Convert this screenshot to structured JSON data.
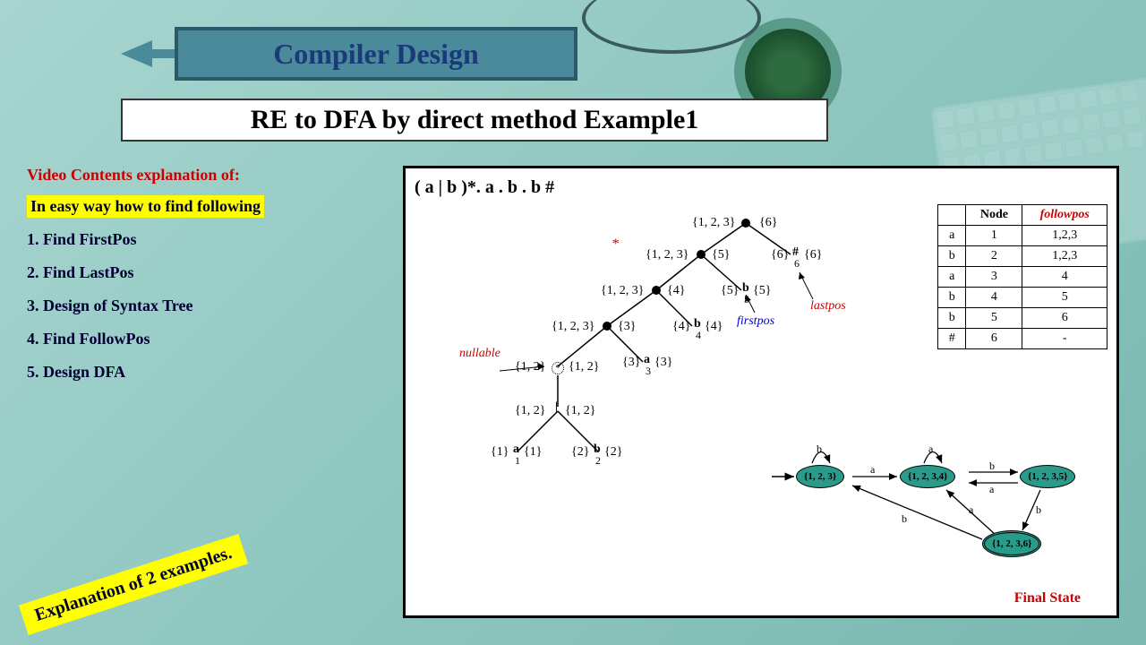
{
  "title": "Compiler Design",
  "subtitle": "RE to DFA by direct method Example1",
  "contents_header": "Video Contents explanation of:",
  "highlight": "In easy way how to find following",
  "items": [
    "1.  Find FirstPos",
    "2.  Find LastPos",
    "3.  Design of Syntax Tree",
    "4.  Find FollowPos",
    "5.  Design DFA"
  ],
  "badge": "Explanation of 2 examples.",
  "expression": "( a | b )*. a . b . b #",
  "tree_labels": {
    "nullable": "nullable",
    "firstpos": "firstpos",
    "lastpos": "lastpos",
    "root_l": "{1, 2, 3}",
    "root_r": "{6}",
    "n5_l": "{1, 2, 3}",
    "n5_r": "{5}",
    "n4_l": "{1, 2, 3}",
    "n4_r": "{4}",
    "n3_l": "{1, 2, 3}",
    "n3_r": "{3}",
    "star_l": "{1, 2}",
    "star_r": "{1, 2}",
    "or_l": "{1, 2}",
    "or_r": "{1, 2}",
    "a1_l": "{1}",
    "a1": "a",
    "a1_sub": "1",
    "a1_r": "{1}",
    "b2_l": "{2}",
    "b2": "b",
    "b2_sub": "2",
    "b2_r": "{2}",
    "a3_l": "{3}",
    "a3": "a",
    "a3_sub": "3",
    "a3_r": "{3}",
    "b4_l": "{4}",
    "b4": "b",
    "b4_sub": "4",
    "b4_r": "{4}",
    "b5_l": "{5}",
    "b5": "b",
    "b5_sub": "5",
    "b5_r": "{5}",
    "h6_l": "{6}",
    "h6": "#",
    "h6_sub": "6",
    "h6_r": "{6}"
  },
  "followpos": {
    "headers": [
      "",
      "Node",
      "followpos"
    ],
    "rows": [
      [
        "a",
        "1",
        "1,2,3"
      ],
      [
        "b",
        "2",
        "1,2,3"
      ],
      [
        "a",
        "3",
        "4"
      ],
      [
        "b",
        "4",
        "5"
      ],
      [
        "b",
        "5",
        "6"
      ],
      [
        "#",
        "6",
        "-"
      ]
    ]
  },
  "dfa": {
    "states": [
      {
        "id": "s1",
        "label": "{1, 2, 3}"
      },
      {
        "id": "s2",
        "label": "{1, 2, 3,4}"
      },
      {
        "id": "s3",
        "label": "{1, 2, 3,5}"
      },
      {
        "id": "s4",
        "label": "{1, 2, 3,6}"
      }
    ],
    "final_label": "Final State",
    "edges": [
      "a",
      "b",
      "a",
      "b",
      "a",
      "b",
      "a",
      "b"
    ]
  }
}
